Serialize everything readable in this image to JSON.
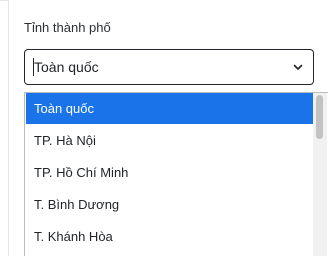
{
  "field": {
    "label": "Tỉnh thành phố",
    "value": "Toàn quốc"
  },
  "icons": {
    "dropdown": "chevron-down-icon"
  },
  "dropdown": {
    "options": [
      {
        "label": "Toàn quốc",
        "selected": true
      },
      {
        "label": "TP. Hà Nội"
      },
      {
        "label": "TP. Hồ Chí Minh"
      },
      {
        "label": "T. Bình Dương"
      },
      {
        "label": "T. Khánh Hòa"
      }
    ]
  },
  "colors": {
    "selected_background": "#1a73e8",
    "selected_text": "#ffffff"
  }
}
